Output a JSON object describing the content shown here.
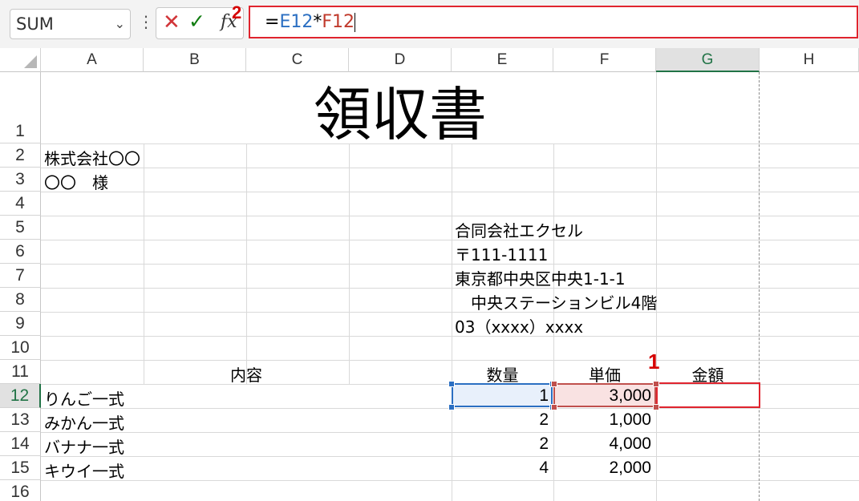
{
  "formula_bar": {
    "name_box": "SUM",
    "more_glyph": "⋮",
    "cancel_glyph": "✕",
    "enter_glyph": "✓",
    "fx_glyph": "fx",
    "formula_eq": "=",
    "formula_ref1": "E12",
    "formula_op": "*",
    "formula_ref2": "F12"
  },
  "markers": {
    "one": "1",
    "two": "2"
  },
  "columns": [
    "A",
    "B",
    "C",
    "D",
    "E",
    "F",
    "G",
    "H"
  ],
  "rows": [
    "1",
    "2",
    "3",
    "4",
    "5",
    "6",
    "7",
    "8",
    "9",
    "10",
    "11",
    "12",
    "13",
    "14",
    "15",
    "16"
  ],
  "cells": {
    "title": "領収書",
    "a2": "株式会社〇〇",
    "a3": "〇〇　様",
    "e5": "合同会社エクセル",
    "e6": "〒111-1111",
    "e7": "東京都中央区中央1-1-1",
    "e8": "　中央ステーションビル4階",
    "e9": "03（xxxx）xxxx",
    "h_content": "内容",
    "h_qty": "数量",
    "h_price": "単価",
    "h_amount": "金額"
  },
  "items": [
    {
      "name": "りんご一式",
      "qty": "1",
      "price": "3,000"
    },
    {
      "name": "みかん一式",
      "qty": "2",
      "price": "1,000"
    },
    {
      "name": "バナナ一式",
      "qty": "2",
      "price": "4,000"
    },
    {
      "name": "キウイ一式",
      "qty": "4",
      "price": "2,000"
    }
  ],
  "colors": {
    "accent_green": "#217346",
    "highlight_red": "#e0242e",
    "ref_blue": "#2b6fc2",
    "ref_red": "#c0504d"
  }
}
